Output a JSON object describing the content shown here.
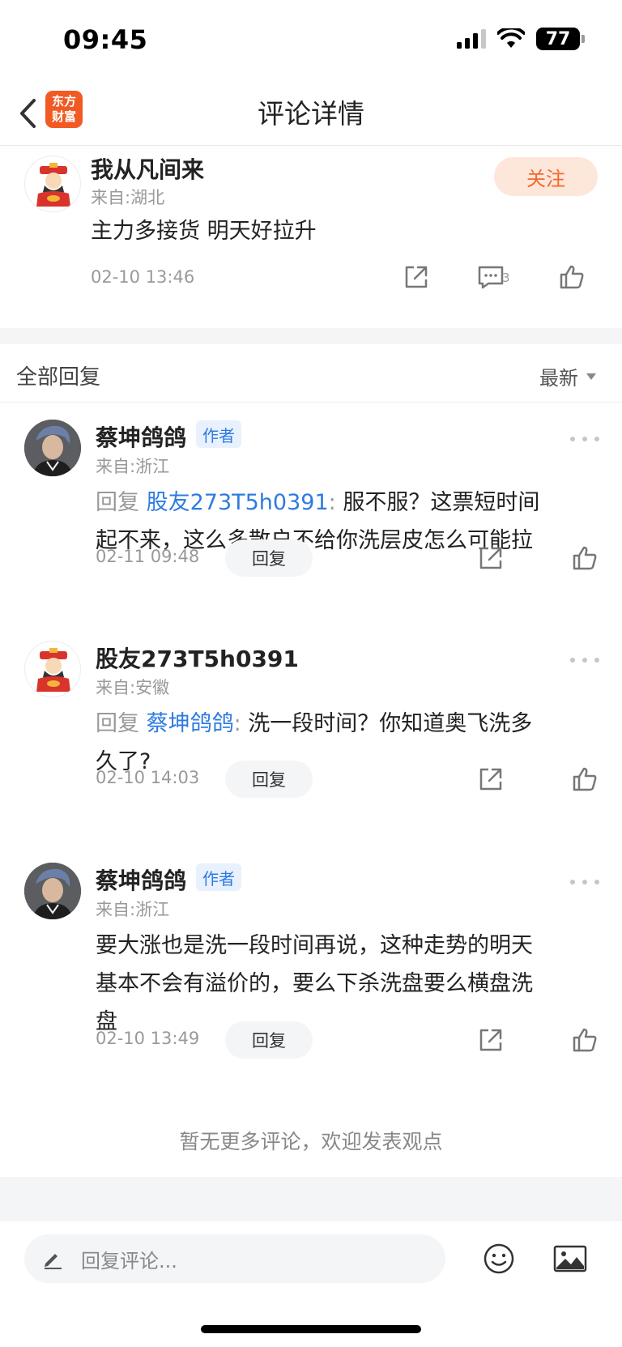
{
  "status_bar": {
    "time": "09:45",
    "battery": "77"
  },
  "nav": {
    "title": "评论详情",
    "logo_line1": "东方",
    "logo_line2": "财富"
  },
  "main_comment": {
    "user": "我从凡间来",
    "location": "来自:湖北",
    "text": "主力多接货 明天好拉升",
    "time": "02-10 13:46",
    "follow_label": "关注",
    "comment_count": "3"
  },
  "replies_header": {
    "title": "全部回复",
    "sort": "最新"
  },
  "replies": [
    {
      "user": "蔡坤鸽鸽",
      "badge": "作者",
      "location": "来自:浙江",
      "prefix": "回复",
      "target": "股友273T5h0391",
      "separator": ":",
      "line1": " 服不服？这票短时间",
      "line2": "起不来，这么多散户不给你洗层皮怎么可能拉",
      "time": "02-11 09:48",
      "reply_label": "回复"
    },
    {
      "user": "股友273T5h0391",
      "location": "来自:安徽",
      "prefix": "回复",
      "target": "蔡坤鸽鸽",
      "separator": ":",
      "line1": " 洗一段时间？你知道奥飞洗多",
      "line2": "久了?",
      "time": "02-10 14:03",
      "reply_label": "回复"
    },
    {
      "user": "蔡坤鸽鸽",
      "badge": "作者",
      "location": "来自:浙江",
      "line1": "要大涨也是洗一段时间再说，这种走势的明天",
      "line2": "基本不会有溢价的，要么下杀洗盘要么横盘洗",
      "line3": "盘",
      "time": "02-10 13:49",
      "reply_label": "回复"
    }
  ],
  "end_note": "暂无更多评论，欢迎发表观点",
  "input_bar": {
    "placeholder": "回复评论..."
  },
  "icons": {
    "back": "chevron-left-icon",
    "share": "share-icon",
    "comment": "comment-icon",
    "like": "thumbs-up-icon",
    "more": "more-dots-icon",
    "edit": "pencil-icon",
    "emoji": "emoji-icon",
    "image": "image-icon"
  },
  "colors": {
    "brand": "#f15a22",
    "follow_text": "#f26a2a",
    "link": "#2d7be0"
  }
}
